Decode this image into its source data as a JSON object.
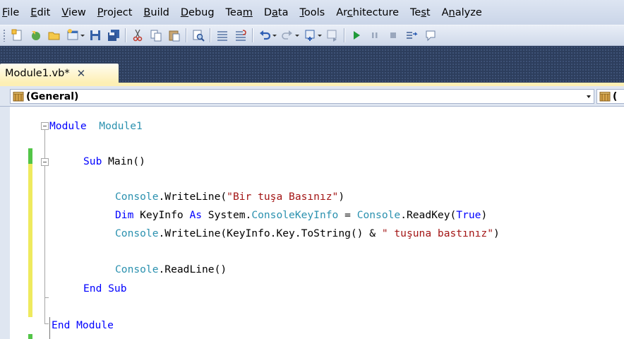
{
  "menu": [
    {
      "label": "File",
      "u": "F",
      "rest": "ile"
    },
    {
      "label": "Edit",
      "u": "E",
      "rest": "dit"
    },
    {
      "label": "View",
      "u": "V",
      "rest": "iew"
    },
    {
      "label": "Project",
      "u": "P",
      "rest": "roject"
    },
    {
      "label": "Build",
      "u": "B",
      "rest": "uild"
    },
    {
      "label": "Debug",
      "u": "D",
      "rest": "ebug"
    },
    {
      "label": "Team",
      "pre": "Tea",
      "u": "m",
      "rest": ""
    },
    {
      "label": "Data",
      "pre": "D",
      "u": "a",
      "rest": "ta"
    },
    {
      "label": "Tools",
      "u": "T",
      "rest": "ools"
    },
    {
      "label": "Architecture",
      "pre": "Ar",
      "u": "c",
      "rest": "hitecture"
    },
    {
      "label": "Test",
      "pre": "Te",
      "u": "s",
      "rest": "t"
    },
    {
      "label": "Analyze",
      "pre": "A",
      "u": "n",
      "rest": "alyze"
    }
  ],
  "toolbar_icons": [
    "new-project-icon",
    "add-new-item-icon",
    "open-file-icon",
    "add-item-icon",
    "save-icon",
    "save-all-icon",
    "cut-icon",
    "copy-icon",
    "paste-icon",
    "find-in-files-icon",
    "comment-icon",
    "uncomment-icon",
    "undo-icon",
    "redo-icon",
    "navigate-backward-icon",
    "navigate-forward-icon",
    "start-debugging-icon",
    "break-all-icon",
    "stop-debugging-icon",
    "step-into-icon"
  ],
  "tab": {
    "title": "Module1.vb*",
    "close": "✕"
  },
  "nav": {
    "left": "(General)",
    "right": "("
  },
  "code": [
    {
      "tokens": [
        [
          "kw",
          "Module"
        ],
        [
          "",
          "  "
        ],
        [
          "ty",
          "Module1"
        ]
      ]
    },
    {
      "tokens": [
        [
          "kw",
          "Sub"
        ],
        [
          "",
          " Main()"
        ]
      ]
    },
    {
      "tokens": [
        [
          "ty",
          "Console"
        ],
        [
          "",
          ".WriteLine("
        ],
        [
          "st",
          "\"Bir tuşa Basınız\""
        ],
        [
          "",
          ")"
        ]
      ]
    },
    {
      "tokens": [
        [
          "kw",
          "Dim"
        ],
        [
          "",
          " KeyInfo "
        ],
        [
          "kw",
          "As"
        ],
        [
          "",
          " System."
        ],
        [
          "ty",
          "ConsoleKeyInfo"
        ],
        [
          "",
          " = "
        ],
        [
          "ty",
          "Console"
        ],
        [
          "",
          ".ReadKey("
        ],
        [
          "kw",
          "True"
        ],
        [
          "",
          ")"
        ]
      ]
    },
    {
      "tokens": [
        [
          "ty",
          "Console"
        ],
        [
          "",
          ".WriteLine(KeyInfo.Key.ToString() & "
        ],
        [
          "st",
          "\" tuşuna bastınız\""
        ],
        [
          "",
          ")"
        ]
      ]
    },
    {
      "tokens": [
        [
          "ty",
          "Console"
        ],
        [
          "",
          ".ReadLine()"
        ]
      ]
    },
    {
      "tokens": [
        [
          "kw",
          "End Sub"
        ]
      ]
    },
    {
      "tokens": [
        [
          "kw",
          "End Module"
        ]
      ]
    }
  ],
  "colors": {
    "keyword": "#0000ff",
    "type": "#2b91af",
    "string": "#a31515",
    "tab_active": "#fdefb4",
    "frame": "#2d3e5d"
  }
}
